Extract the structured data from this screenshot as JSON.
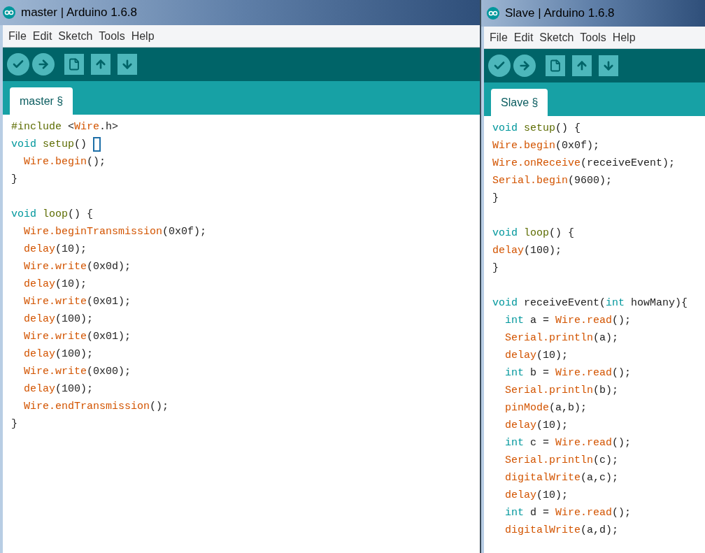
{
  "windows": [
    {
      "title": "master | Arduino 1.6.8",
      "menu": [
        "File",
        "Edit",
        "Sketch",
        "Tools",
        "Help"
      ],
      "tabs": [
        {
          "label": "master §",
          "selected": true
        }
      ],
      "code": [
        {
          "indented": false,
          "tokens": [
            {
              "text": "#include",
              "kind": "pre"
            },
            {
              "text": " <",
              "kind": "plain"
            },
            {
              "text": "Wire",
              "kind": "lib"
            },
            {
              "text": ".h>",
              "kind": "plain"
            }
          ]
        },
        {
          "indented": false,
          "cursor": true,
          "tokens": [
            {
              "text": "void",
              "kind": "type"
            },
            {
              "text": " setup",
              "kind": "func"
            },
            {
              "text": "()",
              "kind": "plain"
            }
          ]
        },
        {
          "indented": true,
          "tokens": [
            {
              "text": "Wire.begin",
              "kind": "lib"
            },
            {
              "text": "();",
              "kind": "plain"
            }
          ]
        },
        {
          "indented": false,
          "tokens": [
            {
              "text": "}",
              "kind": "plain"
            }
          ]
        },
        {
          "indented": false,
          "gap_before": true,
          "tokens": [
            {
              "text": "void",
              "kind": "type"
            },
            {
              "text": " loop",
              "kind": "func"
            },
            {
              "text": "() {",
              "kind": "plain"
            }
          ]
        },
        {
          "indented": true,
          "tokens": [
            {
              "text": "Wire.beginTransmission",
              "kind": "lib"
            },
            {
              "text": "(0x0f);",
              "kind": "plain"
            }
          ]
        },
        {
          "indented": true,
          "tokens": [
            {
              "text": "delay",
              "kind": "lib"
            },
            {
              "text": "(10);",
              "kind": "plain"
            }
          ]
        },
        {
          "indented": true,
          "tokens": [
            {
              "text": "Wire.write",
              "kind": "lib"
            },
            {
              "text": "(0x0d);",
              "kind": "plain"
            }
          ]
        },
        {
          "indented": true,
          "tokens": [
            {
              "text": "delay",
              "kind": "lib"
            },
            {
              "text": "(10);",
              "kind": "plain"
            }
          ]
        },
        {
          "indented": true,
          "tokens": [
            {
              "text": "Wire.write",
              "kind": "lib"
            },
            {
              "text": "(0x01);",
              "kind": "plain"
            }
          ]
        },
        {
          "indented": true,
          "tokens": [
            {
              "text": "delay",
              "kind": "lib"
            },
            {
              "text": "(100);",
              "kind": "plain"
            }
          ]
        },
        {
          "indented": true,
          "tokens": [
            {
              "text": "Wire.write",
              "kind": "lib"
            },
            {
              "text": "(0x01);",
              "kind": "plain"
            }
          ]
        },
        {
          "indented": true,
          "tokens": [
            {
              "text": "delay",
              "kind": "lib"
            },
            {
              "text": "(100);",
              "kind": "plain"
            }
          ]
        },
        {
          "indented": true,
          "tokens": [
            {
              "text": "Wire.write",
              "kind": "lib"
            },
            {
              "text": "(0x00);",
              "kind": "plain"
            }
          ]
        },
        {
          "indented": true,
          "tokens": [
            {
              "text": "delay",
              "kind": "lib"
            },
            {
              "text": "(100);",
              "kind": "plain"
            }
          ]
        },
        {
          "indented": true,
          "tokens": [
            {
              "text": "Wire.endTransmission",
              "kind": "lib"
            },
            {
              "text": "();",
              "kind": "plain"
            }
          ]
        },
        {
          "indented": false,
          "tokens": [
            {
              "text": "}",
              "kind": "plain"
            }
          ]
        }
      ]
    },
    {
      "title": "Slave | Arduino 1.6.8",
      "menu": [
        "File",
        "Edit",
        "Sketch",
        "Tools",
        "Help"
      ],
      "tabs": [
        {
          "label": "Slave §",
          "selected": true
        }
      ],
      "code": [
        {
          "indented": false,
          "tokens": [
            {
              "text": "void",
              "kind": "type"
            },
            {
              "text": " setup",
              "kind": "func"
            },
            {
              "text": "() {",
              "kind": "plain"
            }
          ]
        },
        {
          "indented": false,
          "tokens": [
            {
              "text": "Wire.begin",
              "kind": "lib"
            },
            {
              "text": "(0x0f);",
              "kind": "plain"
            }
          ]
        },
        {
          "indented": false,
          "tokens": [
            {
              "text": "Wire.onReceive",
              "kind": "lib"
            },
            {
              "text": "(receiveEvent);",
              "kind": "plain"
            }
          ]
        },
        {
          "indented": false,
          "tokens": [
            {
              "text": "Serial.begin",
              "kind": "lib"
            },
            {
              "text": "(9600);",
              "kind": "plain"
            }
          ]
        },
        {
          "indented": false,
          "tokens": [
            {
              "text": "}",
              "kind": "plain"
            }
          ]
        },
        {
          "indented": false,
          "gap_before": true,
          "tokens": [
            {
              "text": "void",
              "kind": "type"
            },
            {
              "text": " loop",
              "kind": "func"
            },
            {
              "text": "() {",
              "kind": "plain"
            }
          ]
        },
        {
          "indented": false,
          "tokens": [
            {
              "text": "delay",
              "kind": "lib"
            },
            {
              "text": "(100);",
              "kind": "plain"
            }
          ]
        },
        {
          "indented": false,
          "tokens": [
            {
              "text": "}",
              "kind": "plain"
            }
          ]
        },
        {
          "indented": false,
          "gap_before": true,
          "tokens": [
            {
              "text": "void",
              "kind": "type"
            },
            {
              "text": " receiveEvent(",
              "kind": "plain"
            },
            {
              "text": "int",
              "kind": "type"
            },
            {
              "text": " howMany){",
              "kind": "plain"
            }
          ]
        },
        {
          "indented": true,
          "tokens": [
            {
              "text": "int",
              "kind": "type"
            },
            {
              "text": " a = ",
              "kind": "plain"
            },
            {
              "text": "Wire.read",
              "kind": "lib"
            },
            {
              "text": "();",
              "kind": "plain"
            }
          ]
        },
        {
          "indented": true,
          "tokens": [
            {
              "text": "Serial.println",
              "kind": "lib"
            },
            {
              "text": "(a);",
              "kind": "plain"
            }
          ]
        },
        {
          "indented": true,
          "tokens": [
            {
              "text": "delay",
              "kind": "lib"
            },
            {
              "text": "(10);",
              "kind": "plain"
            }
          ]
        },
        {
          "indented": true,
          "tokens": [
            {
              "text": "int",
              "kind": "type"
            },
            {
              "text": " b = ",
              "kind": "plain"
            },
            {
              "text": "Wire.read",
              "kind": "lib"
            },
            {
              "text": "();",
              "kind": "plain"
            }
          ]
        },
        {
          "indented": true,
          "tokens": [
            {
              "text": "Serial.println",
              "kind": "lib"
            },
            {
              "text": "(b);",
              "kind": "plain"
            }
          ]
        },
        {
          "indented": true,
          "tokens": [
            {
              "text": "pinMode",
              "kind": "lib"
            },
            {
              "text": "(a,b);",
              "kind": "plain"
            }
          ]
        },
        {
          "indented": true,
          "tokens": [
            {
              "text": "delay",
              "kind": "lib"
            },
            {
              "text": "(10);",
              "kind": "plain"
            }
          ]
        },
        {
          "indented": true,
          "tokens": [
            {
              "text": "int",
              "kind": "type"
            },
            {
              "text": " c = ",
              "kind": "plain"
            },
            {
              "text": "Wire.read",
              "kind": "lib"
            },
            {
              "text": "();",
              "kind": "plain"
            }
          ]
        },
        {
          "indented": true,
          "tokens": [
            {
              "text": "Serial.println",
              "kind": "lib"
            },
            {
              "text": "(c);",
              "kind": "plain"
            }
          ]
        },
        {
          "indented": true,
          "tokens": [
            {
              "text": "digitalWrite",
              "kind": "lib"
            },
            {
              "text": "(a,c);",
              "kind": "plain"
            }
          ]
        },
        {
          "indented": true,
          "tokens": [
            {
              "text": "delay",
              "kind": "lib"
            },
            {
              "text": "(10);",
              "kind": "plain"
            }
          ]
        },
        {
          "indented": true,
          "tokens": [
            {
              "text": "int",
              "kind": "type"
            },
            {
              "text": " d = ",
              "kind": "plain"
            },
            {
              "text": "Wire.read",
              "kind": "lib"
            },
            {
              "text": "();",
              "kind": "plain"
            }
          ]
        },
        {
          "indented": true,
          "tokens": [
            {
              "text": "digitalWrite",
              "kind": "lib"
            },
            {
              "text": "(a,d);",
              "kind": "plain"
            }
          ]
        }
      ]
    }
  ]
}
